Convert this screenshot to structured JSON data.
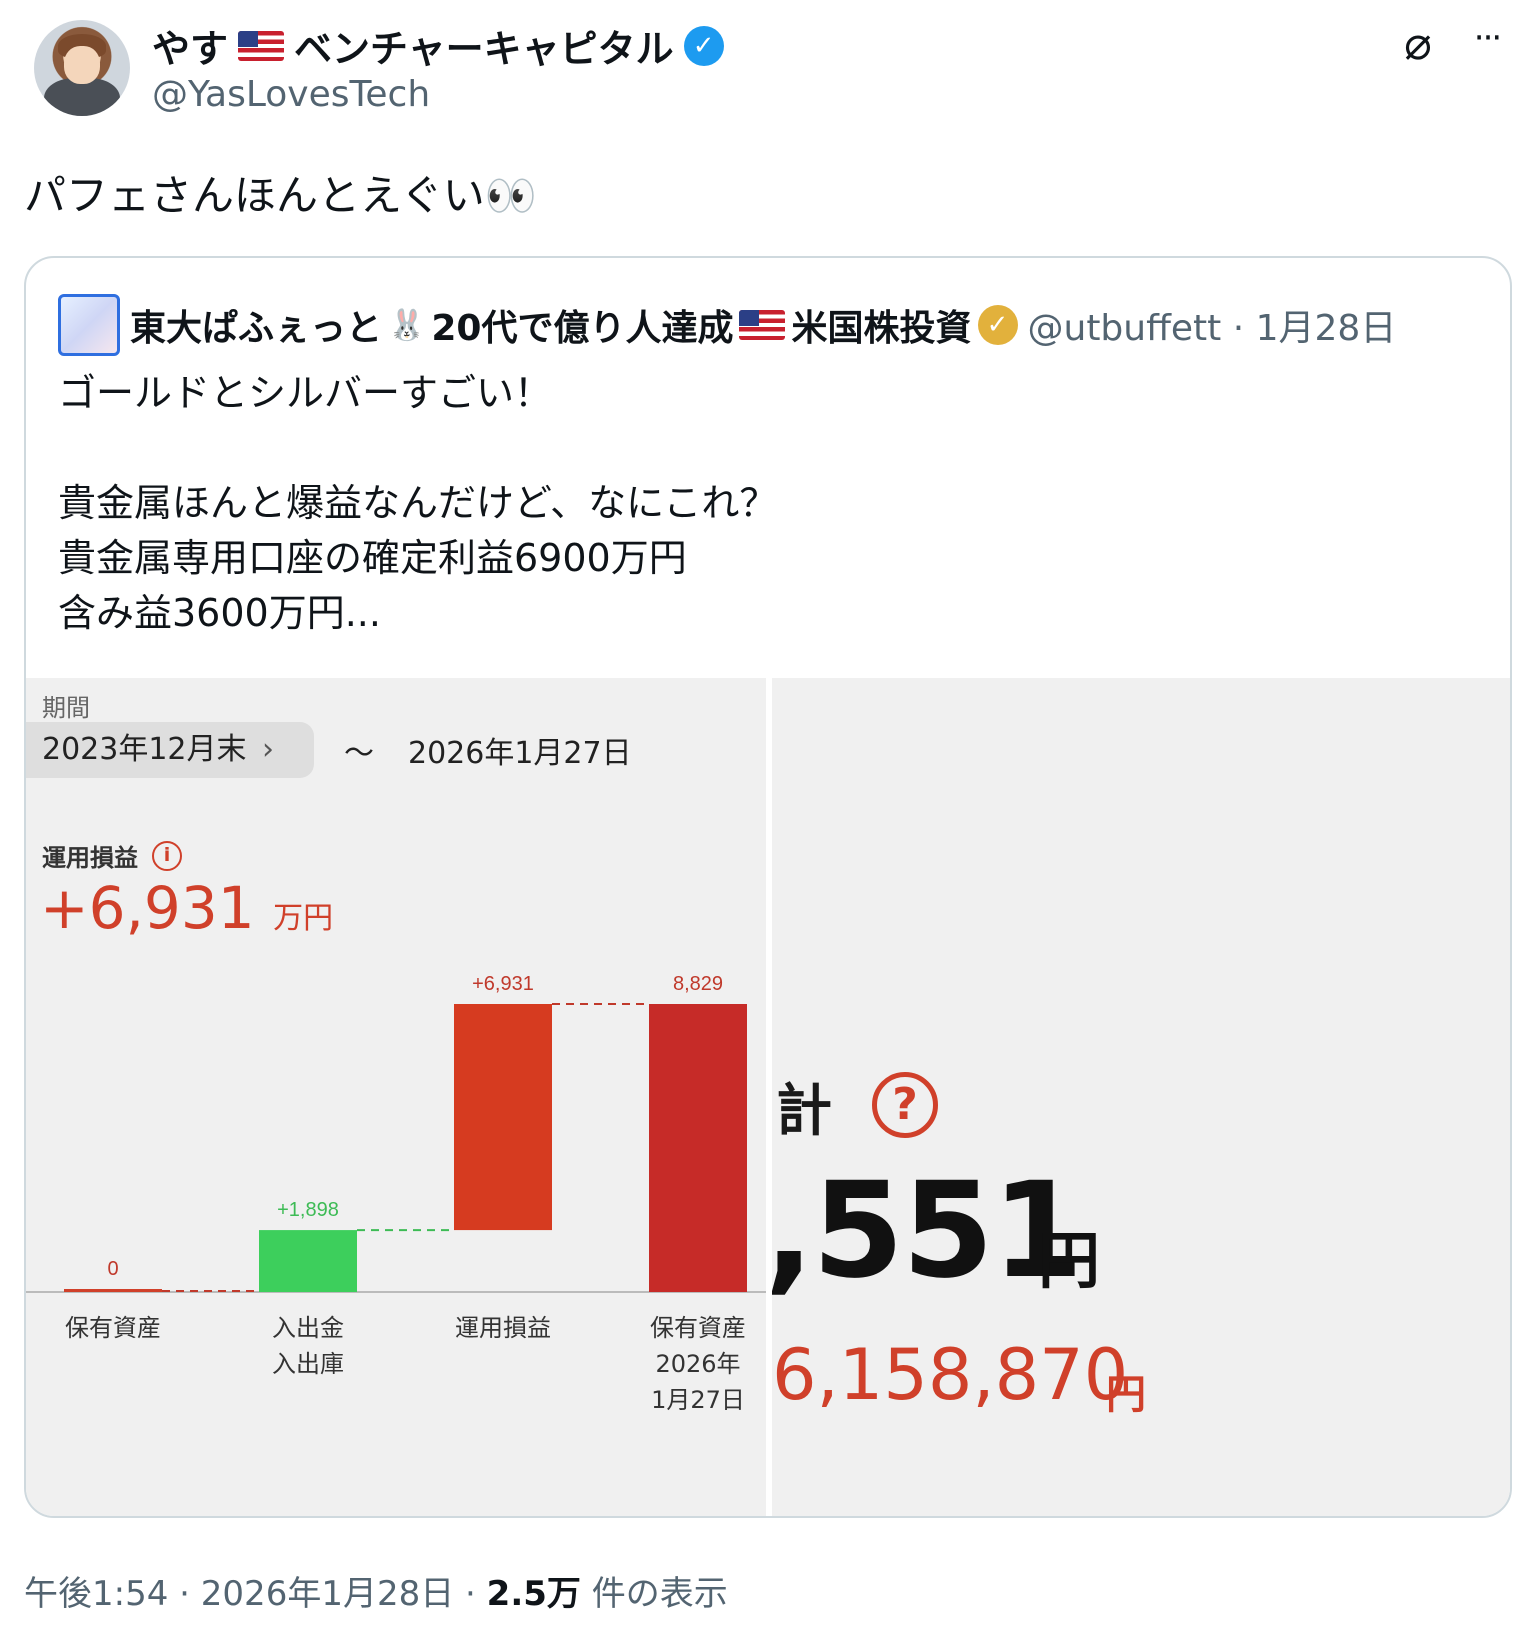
{
  "tweet": {
    "author_name": "やす",
    "author_suffix": "ベンチャーキャピタル",
    "handle": "@YasLovesTech",
    "text": "パフェさんほんとえぐい👀",
    "time": "午後1:54",
    "date": "2026年1月28日",
    "views_count": "2.5万",
    "views_label": "件の表示"
  },
  "quote": {
    "author_name_a": "東大ぱふぇっと",
    "author_name_b": "20代で億り人達成",
    "author_name_c": "米国株投資",
    "handle": "@utbuffett",
    "date": "1月28日",
    "body": "ゴールドとシルバーすごい！\n\n貴金属ほんと爆益なんだけど、なにこれ？\n貴金属専用口座の確定利益6900万円\n含み益3600万円..."
  },
  "image_left": {
    "period_label": "期間",
    "period_start": "2023年12月末",
    "period_tilde": "〜",
    "period_end": "2026年1月27日",
    "pl_label": "運用損益",
    "pl_value": "+6,931",
    "pl_unit": "万円"
  },
  "chart_data": {
    "type": "bar",
    "subtype": "waterfall",
    "categories": [
      "保有資産",
      "入出金\n入出庫",
      "運用損益",
      "保有資産\n2026年\n1月27日"
    ],
    "data_labels": [
      "0",
      "+1,898",
      "+6,931",
      "8,829"
    ],
    "values": [
      0,
      1898,
      6931,
      8829
    ],
    "colors": [
      "#d0402a",
      "#3dcf5c",
      "#d63b20",
      "#c62b28"
    ]
  },
  "image_right": {
    "label_partial": "計",
    "big_number": ",551",
    "big_unit": "円",
    "red_number": "6,158,870",
    "red_unit": "円"
  }
}
